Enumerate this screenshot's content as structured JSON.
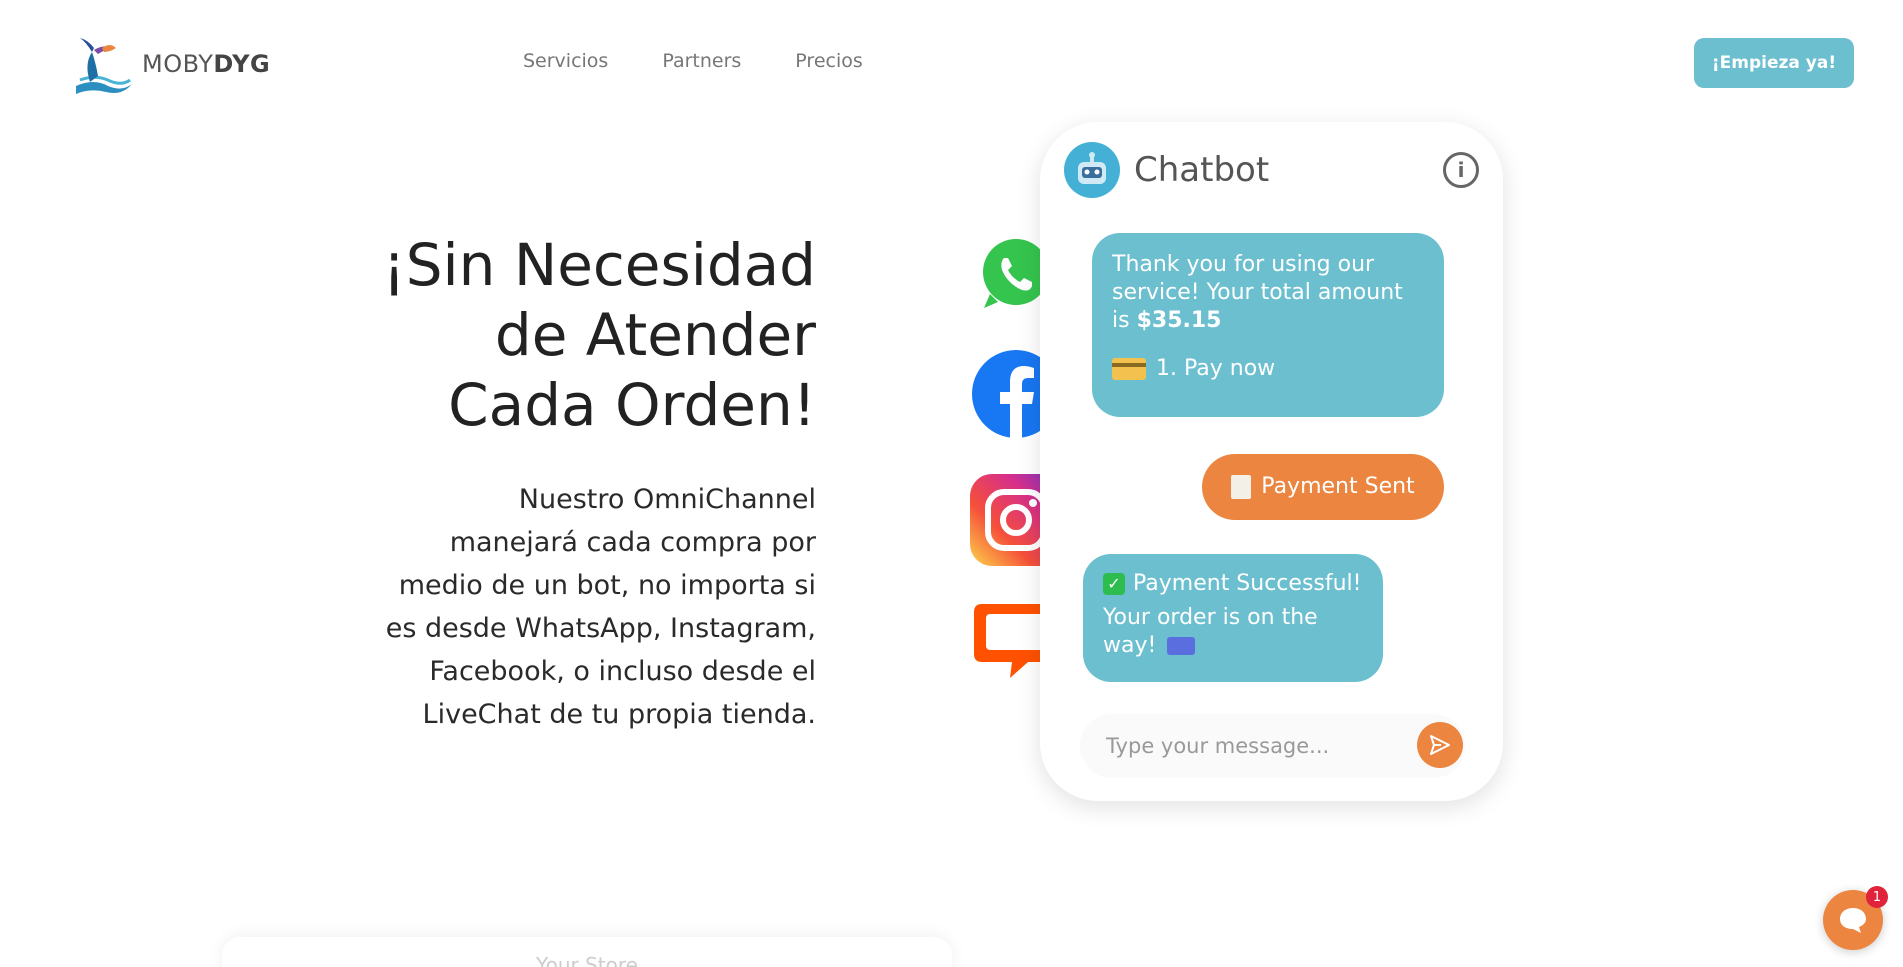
{
  "header": {
    "brand_light": "MOBY",
    "brand_bold": "DYG",
    "nav": [
      {
        "label": "Servicios"
      },
      {
        "label": "Partners"
      },
      {
        "label": "Precios"
      }
    ],
    "cta_label": "¡Empieza ya!"
  },
  "hero": {
    "title_line1": "¡Sin Necesidad",
    "title_line2": "de Atender",
    "title_line3": "Cada Orden!",
    "desc_line1": "Nuestro OmniChannel",
    "desc_line2": "manejará cada compra por",
    "desc_line3": "medio de un bot, no importa si",
    "desc_line4": "es desde WhatsApp, Instagram,",
    "desc_line5": "Facebook, o incluso desde el",
    "desc_line6": "LiveChat de tu propia tienda."
  },
  "social_icons": [
    "whatsapp-icon",
    "facebook-icon",
    "instagram-icon",
    "livechat-icon"
  ],
  "chat": {
    "title": "Chatbot",
    "msg1_text": "Thank you for using our service! Your total amount is ",
    "msg1_amount": "$35.15",
    "msg1_option": "1. Pay now",
    "msg2_text": "Payment Sent",
    "msg3_line1": "Payment Successful!",
    "msg3_line2": "Your order is on the way!",
    "input_placeholder": "Type your message..."
  },
  "store_card_label": "Your Store",
  "launcher_badge": "1",
  "colors": {
    "accent_teal": "#6cbfcf",
    "accent_orange": "#ec8540",
    "badge_red": "#e0233b"
  }
}
